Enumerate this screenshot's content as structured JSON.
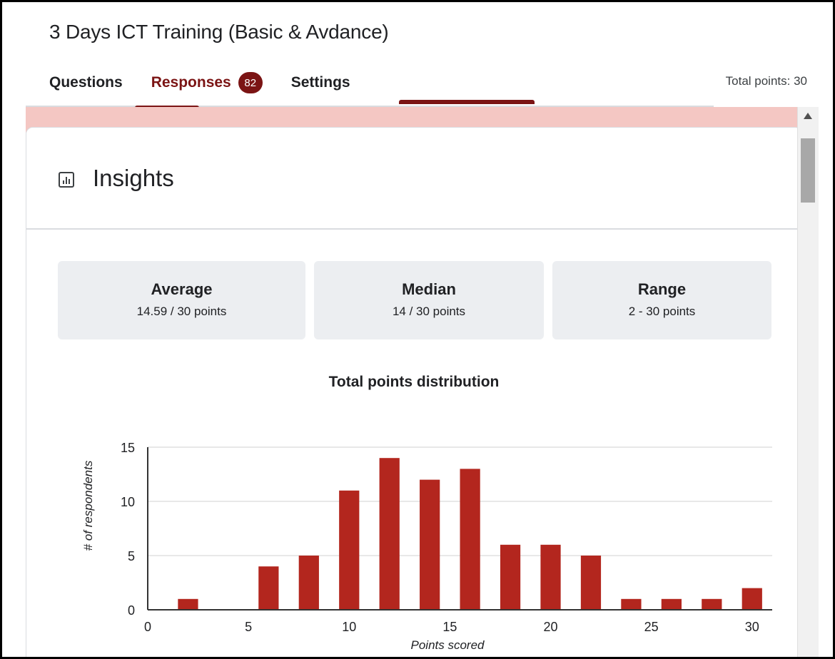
{
  "form": {
    "title": "3 Days ICT Training (Basic & Avdance)"
  },
  "tabs": [
    {
      "label": "Questions"
    },
    {
      "label": "Responses",
      "badge": "82"
    },
    {
      "label": "Settings"
    }
  ],
  "total_points_label": "Total points: 30",
  "insights": {
    "title": "Insights",
    "icon": "bar-chart-icon"
  },
  "stats": [
    {
      "label": "Average",
      "value": "14.59 / 30 points"
    },
    {
      "label": "Median",
      "value": "14 / 30 points"
    },
    {
      "label": "Range",
      "value": "2 - 30 points"
    }
  ],
  "colors": {
    "accent": "#7b1414",
    "bar": "#b3261e",
    "band": "#f4c7c3"
  },
  "chart_data": {
    "type": "bar",
    "title": "Total points distribution",
    "xlabel": "Points scored",
    "ylabel": "# of respondents",
    "x": [
      2,
      6,
      8,
      10,
      12,
      14,
      16,
      18,
      20,
      22,
      24,
      26,
      28,
      30
    ],
    "values": [
      1,
      4,
      5,
      11,
      14,
      12,
      13,
      6,
      6,
      5,
      1,
      1,
      1,
      2
    ],
    "xlim": [
      0,
      31
    ],
    "ylim": [
      0,
      15
    ],
    "xticks": [
      0,
      5,
      10,
      15,
      20,
      25,
      30
    ],
    "yticks": [
      0,
      5,
      10,
      15
    ],
    "grid": true,
    "legend": "none"
  }
}
